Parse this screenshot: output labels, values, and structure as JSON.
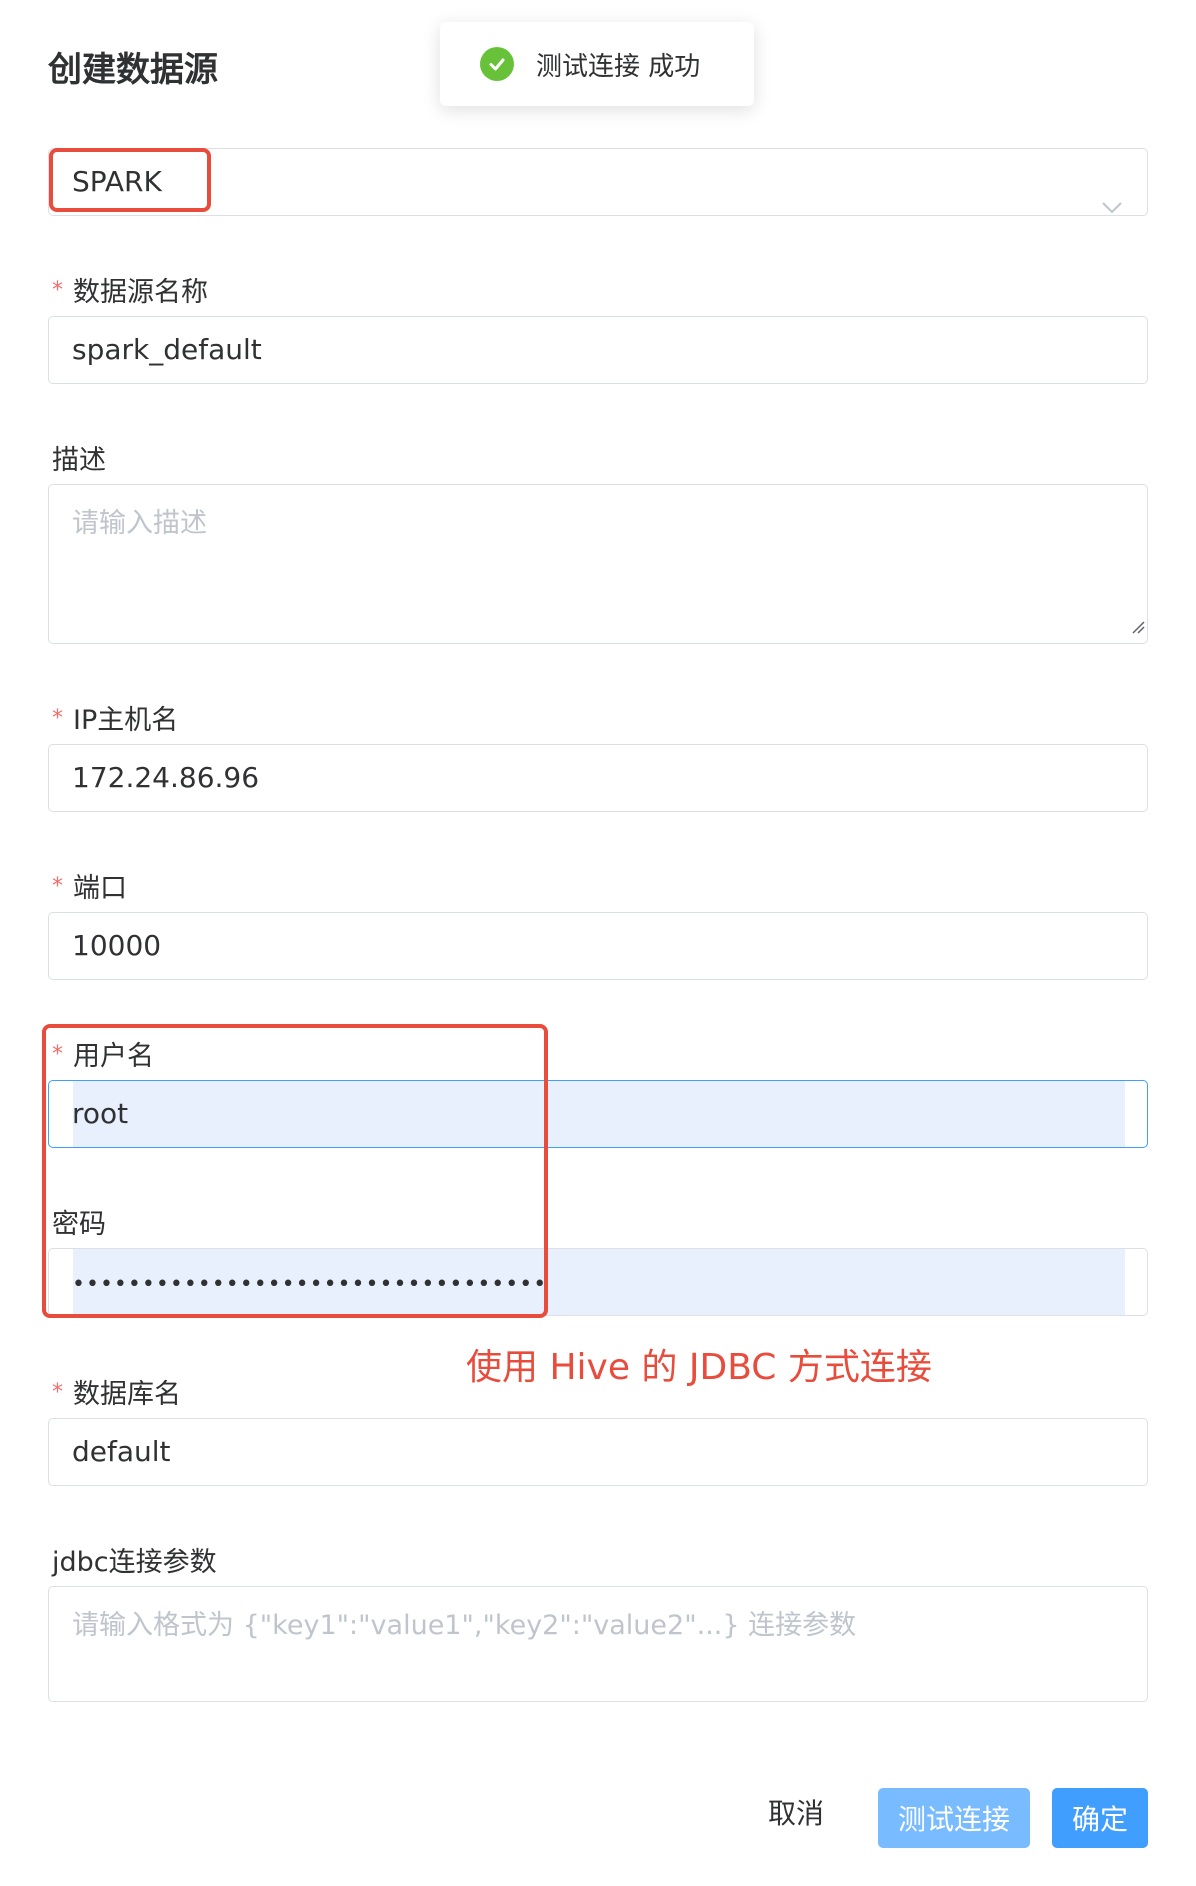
{
  "dialog": {
    "title": "创建数据源"
  },
  "toast": {
    "message": "测试连接 成功",
    "icon": "check-circle-icon",
    "color": "#67c23a"
  },
  "type_select": {
    "value": "SPARK",
    "icon": "chevron-down-icon"
  },
  "fields": {
    "name": {
      "label": "数据源名称",
      "required": true,
      "value": "spark_default"
    },
    "description": {
      "label": "描述",
      "required": false,
      "placeholder": "请输入描述"
    },
    "host": {
      "label": "IP主机名",
      "required": true,
      "value": "172.24.86.96"
    },
    "port": {
      "label": "端口",
      "required": true,
      "value": "10000"
    },
    "username": {
      "label": "用户名",
      "required": true,
      "value": "root"
    },
    "password": {
      "label": "密码",
      "required": false,
      "value": "••••••••••••••••••••••••••••••••••"
    },
    "database": {
      "label": "数据库名",
      "required": true,
      "value": "default"
    },
    "jdbc_params": {
      "label": "jdbc连接参数",
      "required": false,
      "placeholder": "请输入格式为 {\"key1\":\"value1\",\"key2\":\"value2\"...} 连接参数"
    }
  },
  "required_mark": "*",
  "annotation": {
    "text": "使用 Hive 的 JDBC 方式连接",
    "color": "#e74c3c"
  },
  "footer": {
    "cancel_label": "取消",
    "test_label": "测试连接",
    "confirm_label": "确定"
  }
}
